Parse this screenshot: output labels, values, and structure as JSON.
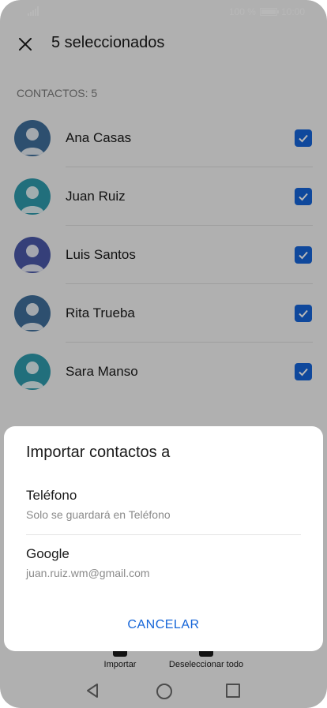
{
  "status_bar": {
    "battery_text": "100 %",
    "time": "10:00"
  },
  "toolbar": {
    "title": "5 seleccionados"
  },
  "section_label": "CONTACTOS: 5",
  "contacts": [
    {
      "name": "Ana Casas",
      "checked": true,
      "avatar_color": "#3f6e9a"
    },
    {
      "name": "Juan Ruiz",
      "checked": true,
      "avatar_color": "#2f9aac"
    },
    {
      "name": "Luis Santos",
      "checked": true,
      "avatar_color": "#4a58a8"
    },
    {
      "name": "Rita Trueba",
      "checked": true,
      "avatar_color": "#3f6e9a"
    },
    {
      "name": "Sara Manso",
      "checked": true,
      "avatar_color": "#2f9aac"
    }
  ],
  "bottom_actions": {
    "import_label": "Importar",
    "deselect_label": "Deseleccionar todo"
  },
  "dialog": {
    "title": "Importar contactos a",
    "options": [
      {
        "title": "Teléfono",
        "subtitle": "Solo se guardará en Teléfono"
      },
      {
        "title": "Google",
        "subtitle": "juan.ruiz.wm@gmail.com"
      }
    ],
    "cancel_label": "CANCELAR"
  },
  "colors": {
    "accent": "#1565d8",
    "scrim": "rgba(0,0,0,0.28)"
  }
}
